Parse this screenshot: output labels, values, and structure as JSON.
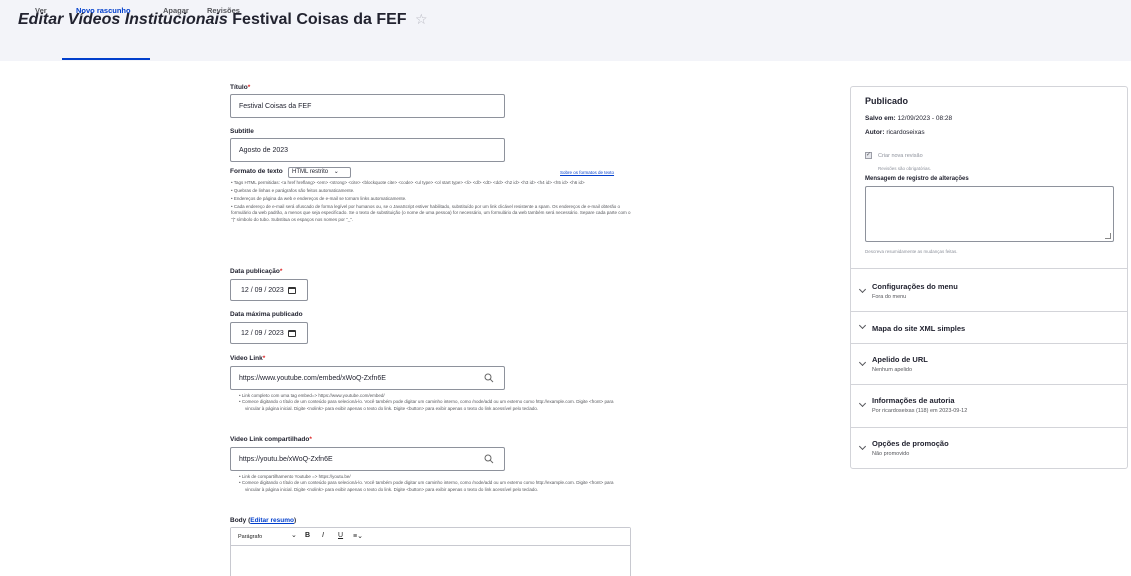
{
  "header": {
    "content_type": "Editar Vídeos Institucionais",
    "node_title": "Festival Coisas da FEF",
    "star": "☆",
    "tabs": [
      "Ver",
      "Novo rascunho",
      "Apagar",
      "Revisões"
    ],
    "active_tab": "Novo rascunho"
  },
  "form": {
    "title": {
      "label": "Título",
      "required": "*",
      "value": "Festival Coisas da FEF"
    },
    "subtitle": {
      "label": "Subtitle",
      "value": "Agosto de 2023"
    },
    "text_format": {
      "label": "Formato de texto",
      "selected": "HTML restrito",
      "help_link": "Sobre os formatos de texto",
      "tips": [
        "Tags HTML permitidas: <a href hreflang> <em> <strong> <cite> <blockquote cite> <code> <ul type> <ol start type> <li> <dl> <dt> <dd> <h2 id> <h3 id> <h4 id> <h5 id> <h6 id>",
        "Quebras de linhas e parágrafos são feitos automaticamente.",
        "Endereços de página da web e endereços de e-mail se tornam links automaticamente.",
        "Cada endereço de e-mail será ofuscado de forma legível por humanos ou, se o JavaScript estiver habilitado, substituído por um link clicável resistente a spam. Os endereços de e-mail obterão o formulário da web padrão, a menos que seja especificado. Se o texto de substituição (o nome de uma pessoa) for necessário, um formulário da web também será necessário. Separe cada parte com o \"|\" símbolo do tubo. Substitua os espaços nos nomes por \"_\"."
      ]
    },
    "pub_date": {
      "label": "Data publicação",
      "required": "*",
      "value": "12 / 09 / 2023"
    },
    "max_date": {
      "label": "Data máxima publicado",
      "value": "12 / 09 / 2023"
    },
    "video_link": {
      "label": "Video Link",
      "required": "*",
      "value": "https://www.youtube.com/embed/xWoQ-Zxfn6E",
      "desc": [
        "Link completo com uma tag embed=> https://www.youtube.com/embed/",
        "Comece digitando o título de um conteúdo para selecioná-lo. Você também pode digitar um caminho interno, como /node/add ou um externo como http://example.com. Digite <front> para vincular à página inicial. Digite <nolink> para exibir apenas o texto do link. Digite <button> para exibir apenas o texto do link acessível pelo teclado."
      ]
    },
    "video_link_shared": {
      "label": "Video Link compartilhado",
      "required": "*",
      "value": "https://youtu.be/xWoQ-Zxfn6E",
      "desc": [
        "Link de compartilhamento Youtube => https://youtu.be/",
        "Comece digitando o título de um conteúdo para selecioná-lo. Você também pode digitar um caminho interno, como /node/add ou um externo como http://example.com. Digite <front> para vincular à página inicial. Digite <nolink> para exibir apenas o texto do link. Digite <button> para exibir apenas o texto do link acessível pelo teclado."
      ]
    },
    "body": {
      "label": "Body",
      "edit_summary": "Editar resumo",
      "paren_open": "(",
      "paren_close": ")",
      "toolbar": {
        "paragraph": "Parágrafo",
        "chevron": "⌄",
        "bold": "B",
        "italic": "I",
        "underline": "U",
        "align": "≡⌄"
      }
    }
  },
  "sidebar": {
    "status": "Publicado",
    "saved_label": "Salvo em:",
    "saved_value": "12/09/2023 - 08:28",
    "author_label": "Autor:",
    "author_value": "ricardoseixas",
    "new_revision": "Criar nova revisão",
    "revision_required": "Revisões são obrigatórias.",
    "revision_log_label": "Mensagem de registro de alterações",
    "revision_log_desc": "Descreva resumidamente as mudanças feitas.",
    "sections": [
      {
        "title": "Configurações do menu",
        "summary": "Fora do menu"
      },
      {
        "title": "Mapa do site XML simples",
        "summary": ""
      },
      {
        "title": "Apelido de URL",
        "summary": "Nenhum apelido"
      },
      {
        "title": "Informações de autoria",
        "summary": "Por ricardoseixas (118) em 2023-09-12"
      },
      {
        "title": "Opções de promoção",
        "summary": "Não promovido"
      }
    ]
  }
}
